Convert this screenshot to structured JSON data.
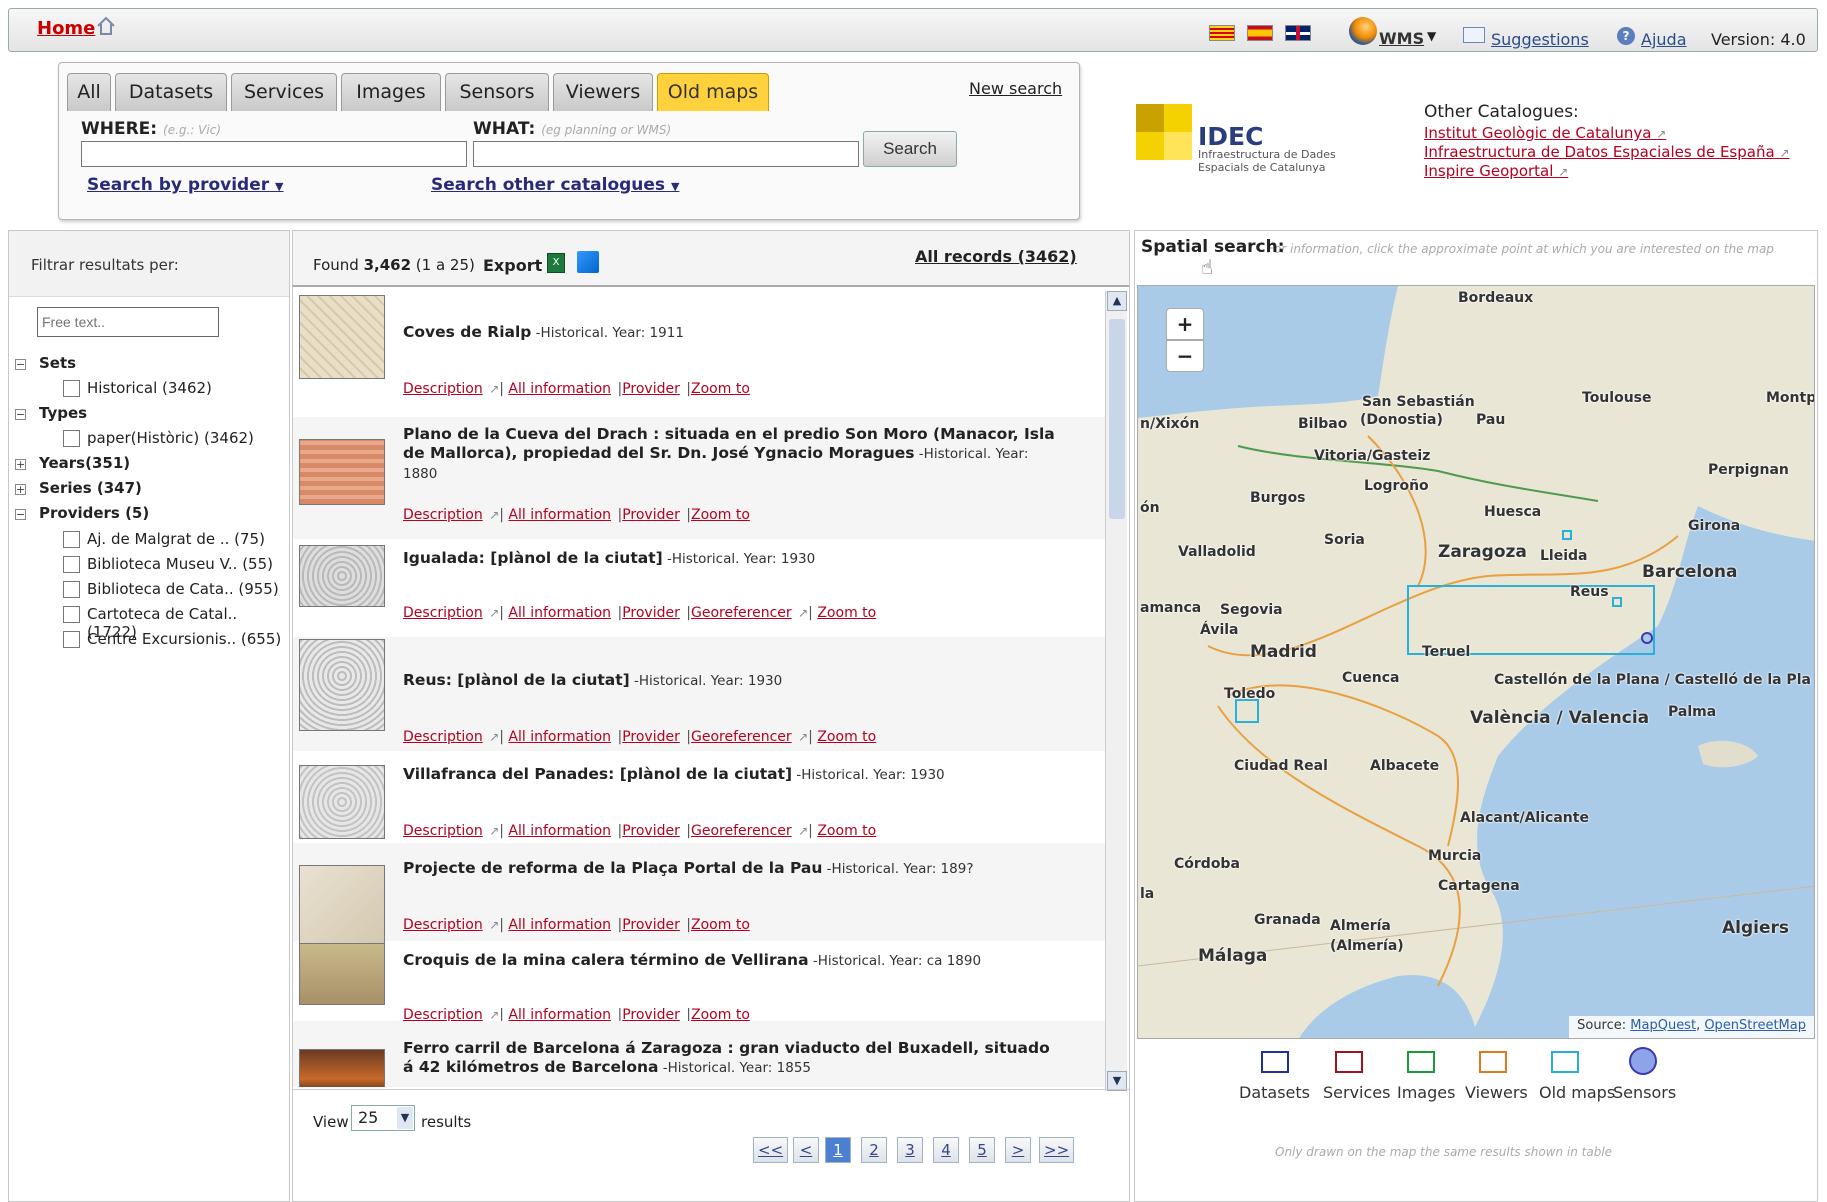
{
  "topbar": {
    "home": "Home",
    "wms": "WMS",
    "suggestions": "Suggestions",
    "help": "Ajuda",
    "version": "Version: 4.0"
  },
  "search": {
    "tabs": [
      "All",
      "Datasets",
      "Services",
      "Images",
      "Sensors",
      "Viewers",
      "Old maps"
    ],
    "active_tab": "Old maps",
    "new_search": "New search",
    "where_label": "WHERE:",
    "where_hint": "(e.g.: Vic)",
    "where_value": "",
    "what_label": "WHAT:",
    "what_hint": "(eg planning or WMS)",
    "what_value": "",
    "search_button": "Search",
    "by_provider": "Search by provider",
    "other_catalogues": "Search other catalogues"
  },
  "idec": {
    "name": "IDEC",
    "sub": "Infraestructura de Dades Espacials de Catalunya"
  },
  "other": {
    "title": "Other Catalogues:",
    "links": [
      "Institut Geològic de Catalunya",
      "Infraestructura de Datos Espaciales de España",
      "Inspire Geoportal"
    ]
  },
  "filter": {
    "title": "Filtrar resultats per:",
    "freetext_placeholder": "Free text..",
    "sets_label": "Sets",
    "sets_item": "Historical (3462)",
    "types_label": "Types",
    "types_item": "paper(Històric) (3462)",
    "years_label": "Years(351)",
    "series_label": "Series (347)",
    "providers_label": "Providers (5)",
    "providers": [
      "Aj. de Malgrat de .. (75)",
      "Biblioteca Museu V.. (55)",
      "Biblioteca de Cata.. (955)",
      "Cartoteca de Catal.. (1722)",
      "Centre Excursionis.. (655)"
    ]
  },
  "results": {
    "found_prefix": "Found ",
    "found_count": "3,462",
    "found_suffix": " (1 a 25)",
    "export": "Export",
    "all_records": "All records (3462)",
    "link_description": "Description",
    "link_allinfo": "All information",
    "link_provider": "Provider",
    "link_georef": "Georeferencer",
    "link_zoom": "Zoom to",
    "items": [
      {
        "title": "Coves de Rialp",
        "meta": " -Historical. Year: 1911"
      },
      {
        "title": "Plano de la Cueva del Drach : situada en el predio Son Moro (Manacor, Isla de Mallorca), propiedad del Sr. Dn. José Ygnacio Moragues",
        "meta": " -Historical. Year: 1880"
      },
      {
        "title": "Igualada: [plànol de la ciutat]",
        "meta": " -Historical. Year: 1930"
      },
      {
        "title": "Reus: [plànol de la ciutat]",
        "meta": " -Historical. Year: 1930"
      },
      {
        "title": "Villafranca del Panades: [plànol de la ciutat]",
        "meta": " -Historical. Year: 1930"
      },
      {
        "title": "Projecte de reforma de la Plaça Portal de la Pau",
        "meta": " -Historical. Year: 189?"
      },
      {
        "title": "Croquis de la mina calera término de Vellirana",
        "meta": " -Historical. Year: ca 1890"
      },
      {
        "title": "Ferro carril de Barcelona á Zaragoza : gran viaducto del Buxadell, situado á 42 kilómetros de Barcelona",
        "meta": " -Historical. Year: 1855"
      }
    ],
    "view_label": "View",
    "view_value": "25",
    "results_label": "results",
    "pages": [
      "<<",
      "<",
      "1",
      "2",
      "3",
      "4",
      "5",
      ">",
      ">>"
    ]
  },
  "map": {
    "title": "Spatial search:",
    "hint": "For information, click the approximate point at which you are interested on the map",
    "source_label": "Source: ",
    "source_links": [
      "MapQuest",
      "OpenStreetMap"
    ],
    "cities": [
      "Bordeaux",
      "Toulouse",
      "Montp",
      "San Sebastián",
      "(Donostia)",
      "Pau",
      "Bilbao",
      "Vitoria/Gasteiz",
      "Logroño",
      "Perpignan",
      "Burgos",
      "Huesca",
      "Girona",
      "Soria",
      "Zaragoza",
      "Lleida",
      "Barcelona",
      "Valladolid",
      "Reus",
      "Segovia",
      "amanca",
      "Ávila",
      "Madrid",
      "Teruel",
      "Cuenca",
      "Toledo",
      "Castellón de la Plana / Castelló de la Pla",
      "València / Valencia",
      "Palma",
      "Ciudad Real",
      "Albacete",
      "Alacant/Alicante",
      "Murcia",
      "Córdoba",
      "Cartagena",
      "Granada",
      "Almería",
      "(Almería)",
      "Málaga",
      "Algiers",
      "n/Xixón",
      "ón",
      "la"
    ],
    "legend": [
      "Datasets",
      "Services",
      "Images",
      "Viewers",
      "Old maps",
      "Sensors"
    ],
    "legend_colors": [
      "#1f2f9e",
      "#a0121e",
      "#1c9a3a",
      "#e07a20",
      "#2ab0d8",
      "#3a3ab0"
    ],
    "note": "Only drawn on the map the same results shown in table"
  }
}
